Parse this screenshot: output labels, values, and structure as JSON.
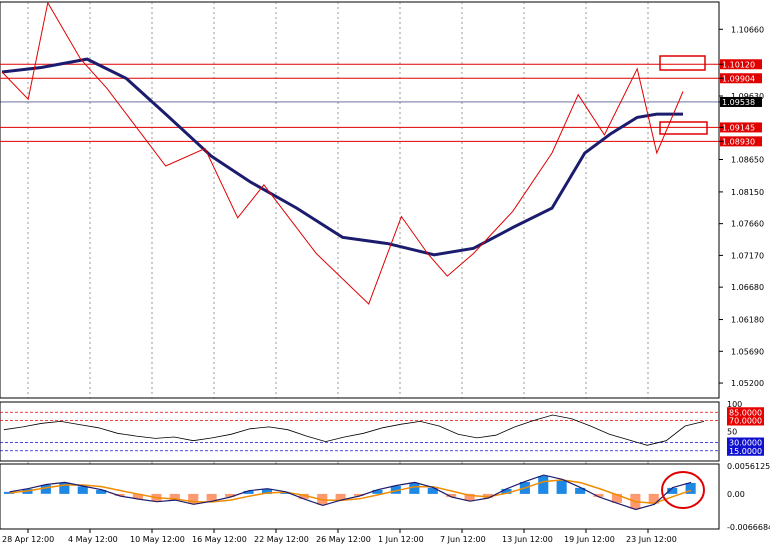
{
  "chart_data": {
    "type": "line",
    "main_panel": {
      "y_ticks": [
        "1.10660",
        "1.10120",
        "1.09904",
        "1.09630",
        "1.09538",
        "1.09145",
        "1.08930",
        "1.08650",
        "1.08150",
        "1.07660",
        "1.07170",
        "1.06680",
        "1.06180",
        "1.05690",
        "1.05200"
      ],
      "ylim": [
        1.05,
        1.1105
      ],
      "current_price": "1.09538",
      "level_labels": [
        {
          "text": "1.10120",
          "value": 1.1012
        },
        {
          "text": "1.09904",
          "value": 1.09904
        },
        {
          "text": "1.09145",
          "value": 1.09145
        },
        {
          "text": "1.08930",
          "value": 1.0893
        }
      ],
      "price_series": [
        {
          "x": 0,
          "y": 1.1
        },
        {
          "x": 4,
          "y": 1.0958
        },
        {
          "x": 7,
          "y": 1.1107
        },
        {
          "x": 12,
          "y": 1.102
        },
        {
          "x": 16,
          "y": 1.0975
        },
        {
          "x": 25,
          "y": 1.0855
        },
        {
          "x": 31,
          "y": 1.0882
        },
        {
          "x": 36,
          "y": 1.0775
        },
        {
          "x": 40,
          "y": 1.0826
        },
        {
          "x": 48,
          "y": 1.072
        },
        {
          "x": 56,
          "y": 1.0642
        },
        {
          "x": 61,
          "y": 1.0777
        },
        {
          "x": 65,
          "y": 1.072
        },
        {
          "x": 68,
          "y": 1.0685
        },
        {
          "x": 72,
          "y": 1.072
        },
        {
          "x": 78,
          "y": 1.0785
        },
        {
          "x": 84,
          "y": 1.0875
        },
        {
          "x": 88,
          "y": 1.0965
        },
        {
          "x": 92,
          "y": 1.0903
        },
        {
          "x": 97,
          "y": 1.1005
        },
        {
          "x": 100,
          "y": 1.0875
        },
        {
          "x": 104,
          "y": 1.097
        }
      ],
      "ma_series": [
        {
          "x": 0,
          "y": 1.1
        },
        {
          "x": 6,
          "y": 1.1007
        },
        {
          "x": 13,
          "y": 1.102
        },
        {
          "x": 19,
          "y": 1.099
        },
        {
          "x": 25,
          "y": 1.0935
        },
        {
          "x": 32,
          "y": 1.087
        },
        {
          "x": 38,
          "y": 1.083
        },
        {
          "x": 45,
          "y": 1.079
        },
        {
          "x": 52,
          "y": 1.0745
        },
        {
          "x": 59,
          "y": 1.0735
        },
        {
          "x": 66,
          "y": 1.0718
        },
        {
          "x": 72,
          "y": 1.0728
        },
        {
          "x": 78,
          "y": 1.076
        },
        {
          "x": 84,
          "y": 1.079
        },
        {
          "x": 89,
          "y": 1.0875
        },
        {
          "x": 93,
          "y": 1.0905
        },
        {
          "x": 97,
          "y": 1.093
        },
        {
          "x": 100,
          "y": 1.0935
        },
        {
          "x": 104,
          "y": 1.0935
        }
      ]
    },
    "oscillator_panel": {
      "y_ticks": [
        "100",
        "85.0000",
        "70.0000",
        "50",
        "30.0000",
        "15.0000"
      ],
      "ylim": [
        0,
        100
      ],
      "level_labels": [
        {
          "text": "85.0000",
          "value": 85,
          "color": "#e80000"
        },
        {
          "text": "70.0000",
          "value": 70,
          "color": "#e80000"
        },
        {
          "text": "30.0000",
          "value": 30,
          "color": "#1010d0"
        },
        {
          "text": "15.0000",
          "value": 15,
          "color": "#1010d0"
        }
      ]
    },
    "macd_panel": {
      "y_ticks": [
        "0.0056125",
        "0.00",
        "-0.0066684"
      ],
      "ylim": [
        -0.0066684,
        0.0056125
      ],
      "histogram": [
        0.0004,
        0.001,
        0.0018,
        0.0022,
        0.0015,
        0.0008,
        -0.0004,
        -0.001,
        -0.0015,
        -0.0012,
        -0.002,
        -0.0014,
        -0.0006,
        0.0006,
        0.001,
        0.0004,
        -0.001,
        -0.0022,
        -0.0012,
        -0.0004,
        0.0008,
        0.0016,
        0.0022,
        0.0012,
        -0.0006,
        -0.0014,
        -0.0008,
        0.001,
        0.0024,
        0.0036,
        0.0028,
        0.0012,
        -0.0006,
        -0.0018,
        -0.003,
        -0.002,
        0.0012,
        0.0022
      ]
    },
    "x_ticks": [
      "28 Apr 12:00",
      "4 May 12:00",
      "10 May 12:00",
      "16 May 12:00",
      "22 May 12:00",
      "26 May 12:00",
      "1 Jun 12:00",
      "7 Jun 12:00",
      "13 Jun 12:00",
      "19 Jun 12:00",
      "23 Jun 12:00"
    ],
    "grid": true,
    "colors": {
      "price": "#e00000",
      "ma": "#1c1c6e",
      "level": "#e00000",
      "hist_up": "#1e88e5",
      "hist_down": "#ff9a70",
      "signal": "#f08c00"
    }
  }
}
